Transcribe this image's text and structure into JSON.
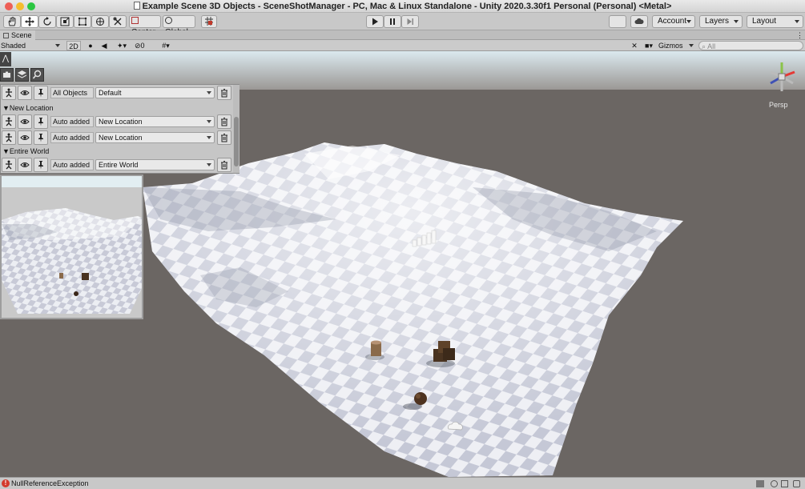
{
  "window": {
    "title": "Example Scene 3D Objects - SceneShotManager - PC, Mac & Linux Standalone - Unity 2020.3.30f1 Personal (Personal) <Metal>"
  },
  "toolbar": {
    "tools": [
      "hand-tool-icon",
      "move-tool-icon",
      "rotate-tool-icon",
      "scale-tool-icon",
      "rect-tool-icon",
      "transform-tool-icon",
      "custom-tool-icon"
    ],
    "pivot_label": "Center",
    "space_label": "Global",
    "account_label": "Account",
    "layers_label": "Layers",
    "layout_label": "Layout"
  },
  "scene_tab": {
    "label": "Scene"
  },
  "scene_toolbar": {
    "shading_mode": "Shaded",
    "mode_2d": "2D",
    "hidden_count": "0",
    "gizmos_label": "Gizmos",
    "search_placeholder": "All"
  },
  "orientation": {
    "projection_label": "Persp"
  },
  "shot_panel": {
    "sections": [
      {
        "header": "",
        "rows": [
          {
            "label": "All Objects",
            "option": "Default"
          }
        ]
      },
      {
        "header": "New Location",
        "rows": [
          {
            "label": "Auto added",
            "option": "New Location"
          },
          {
            "label": "Auto added",
            "option": "New Location"
          }
        ]
      },
      {
        "header": "Entire World",
        "rows": [
          {
            "label": "Auto added",
            "option": "Entire World"
          }
        ]
      }
    ]
  },
  "status": {
    "message": "NullReferenceException"
  },
  "colors": {
    "accent": "#3b6fd6",
    "error": "#d33a2c",
    "viewport_bg": "#6b6663",
    "sky": "#e4eef3"
  }
}
